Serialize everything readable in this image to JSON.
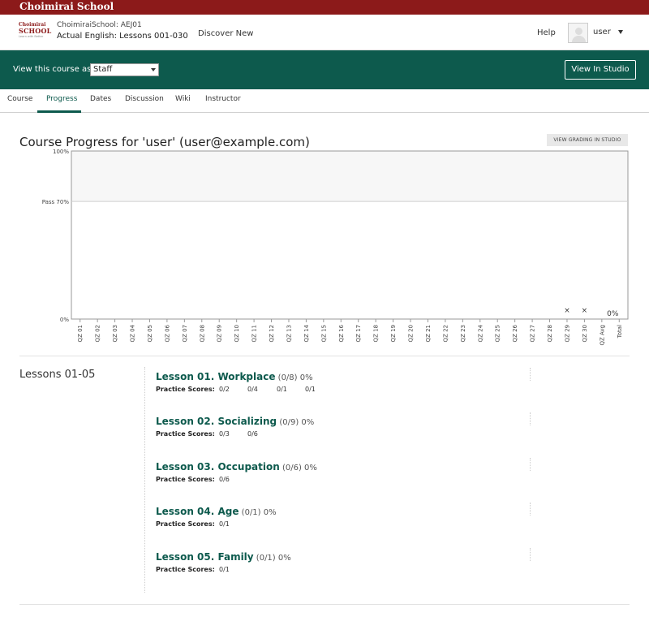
{
  "brand": "Choimirai School",
  "logo": {
    "line1": "Choimirai",
    "line2": "SCHOOL",
    "line3": "Learn with Better"
  },
  "header": {
    "course_org": "ChoimiraiSchool: AEJ01",
    "course_name": "Actual English: Lessons 001-030",
    "discover": "Discover New",
    "help": "Help",
    "username": "user"
  },
  "staff_bar": {
    "label": "View this course as:",
    "selected": "Staff",
    "studio_button": "View In Studio"
  },
  "tabs": [
    {
      "label": "Course"
    },
    {
      "label": "Progress"
    },
    {
      "label": "Dates"
    },
    {
      "label": "Discussion"
    },
    {
      "label": "Wiki"
    },
    {
      "label": "Instructor"
    }
  ],
  "page_title": "Course Progress for 'user' (user@example.com)",
  "grading_button": "VIEW GRADING IN STUDIO",
  "chart_data": {
    "type": "scatter",
    "y_ticks": [
      "100%",
      "Pass 70%",
      "0%"
    ],
    "categories": [
      "QZ 01",
      "QZ 02",
      "QZ 03",
      "QZ 04",
      "QZ 05",
      "QZ 06",
      "QZ 07",
      "QZ 08",
      "QZ 09",
      "QZ 10",
      "QZ 11",
      "QZ 12",
      "QZ 13",
      "QZ 14",
      "QZ 15",
      "QZ 16",
      "QZ 17",
      "QZ 18",
      "QZ 19",
      "QZ 20",
      "QZ 21",
      "QZ 22",
      "QZ 23",
      "QZ 24",
      "QZ 25",
      "QZ 26",
      "QZ 27",
      "QZ 28",
      "QZ 29",
      "QZ 30",
      "QZ Avg",
      "Total"
    ],
    "marked_categories": [
      "QZ 29",
      "QZ 30"
    ],
    "marker": "×",
    "total_label": "0%",
    "ylim": [
      0,
      100
    ],
    "pass_line": 70
  },
  "chapter": {
    "title": "Lessons 01-05",
    "scores_label": "Practice Scores:",
    "sections": [
      {
        "name": "Lesson 01. Workplace",
        "fraction": "(0/8)",
        "percent": "0%",
        "scores": [
          "0/2",
          "0/4",
          "0/1",
          "0/1"
        ]
      },
      {
        "name": "Lesson 02. Socializing",
        "fraction": "(0/9)",
        "percent": "0%",
        "scores": [
          "0/3",
          "0/6"
        ]
      },
      {
        "name": "Lesson 03. Occupation",
        "fraction": "(0/6)",
        "percent": "0%",
        "scores": [
          "0/6"
        ]
      },
      {
        "name": "Lesson 04. Age",
        "fraction": "(0/1)",
        "percent": "0%",
        "scores": [
          "0/1"
        ]
      },
      {
        "name": "Lesson 05. Family",
        "fraction": "(0/1)",
        "percent": "0%",
        "scores": [
          "0/1"
        ]
      }
    ]
  }
}
